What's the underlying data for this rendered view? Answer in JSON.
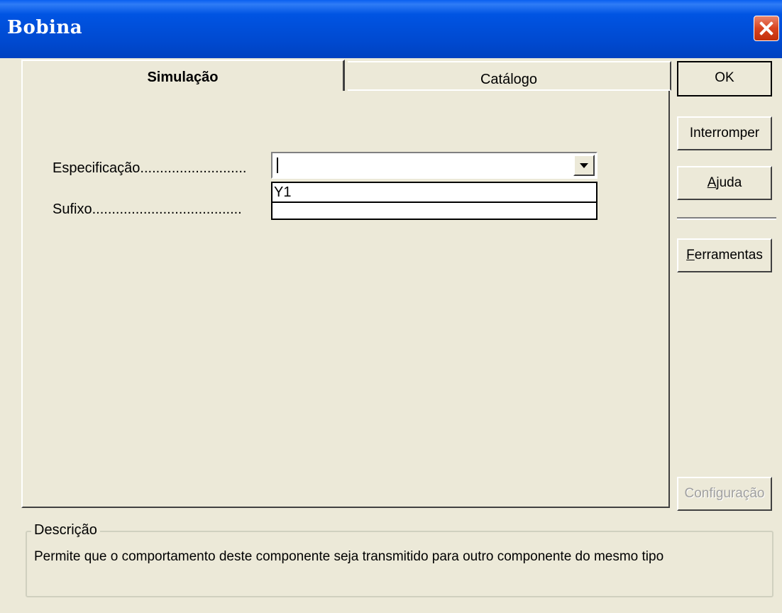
{
  "window": {
    "title": "Bobina",
    "close_icon": "close-icon"
  },
  "tabs": [
    {
      "label": "Simulação",
      "active": true
    },
    {
      "label": "Catálogo",
      "active": false
    }
  ],
  "form": {
    "especificacao_label": "Especificação...........................",
    "especificacao_value": "",
    "sufixo_label": "Sufixo......................................",
    "dropdown_options": [
      "Y1",
      ""
    ]
  },
  "buttons": {
    "ok": "OK",
    "interromper": "Interromper",
    "ajuda_first": "A",
    "ajuda_rest": "juda",
    "ferramentas_first": "F",
    "ferramentas_rest": "erramentas",
    "configuracao": "Configuração"
  },
  "description": {
    "label": "Descrição",
    "text": "Permite que o comportamento deste componente seja transmitido para outro componente do mesmo tipo"
  },
  "colors": {
    "title_bar": "#0054e3",
    "dialog_bg": "#ece9d8",
    "close_button": "#d9431f"
  }
}
